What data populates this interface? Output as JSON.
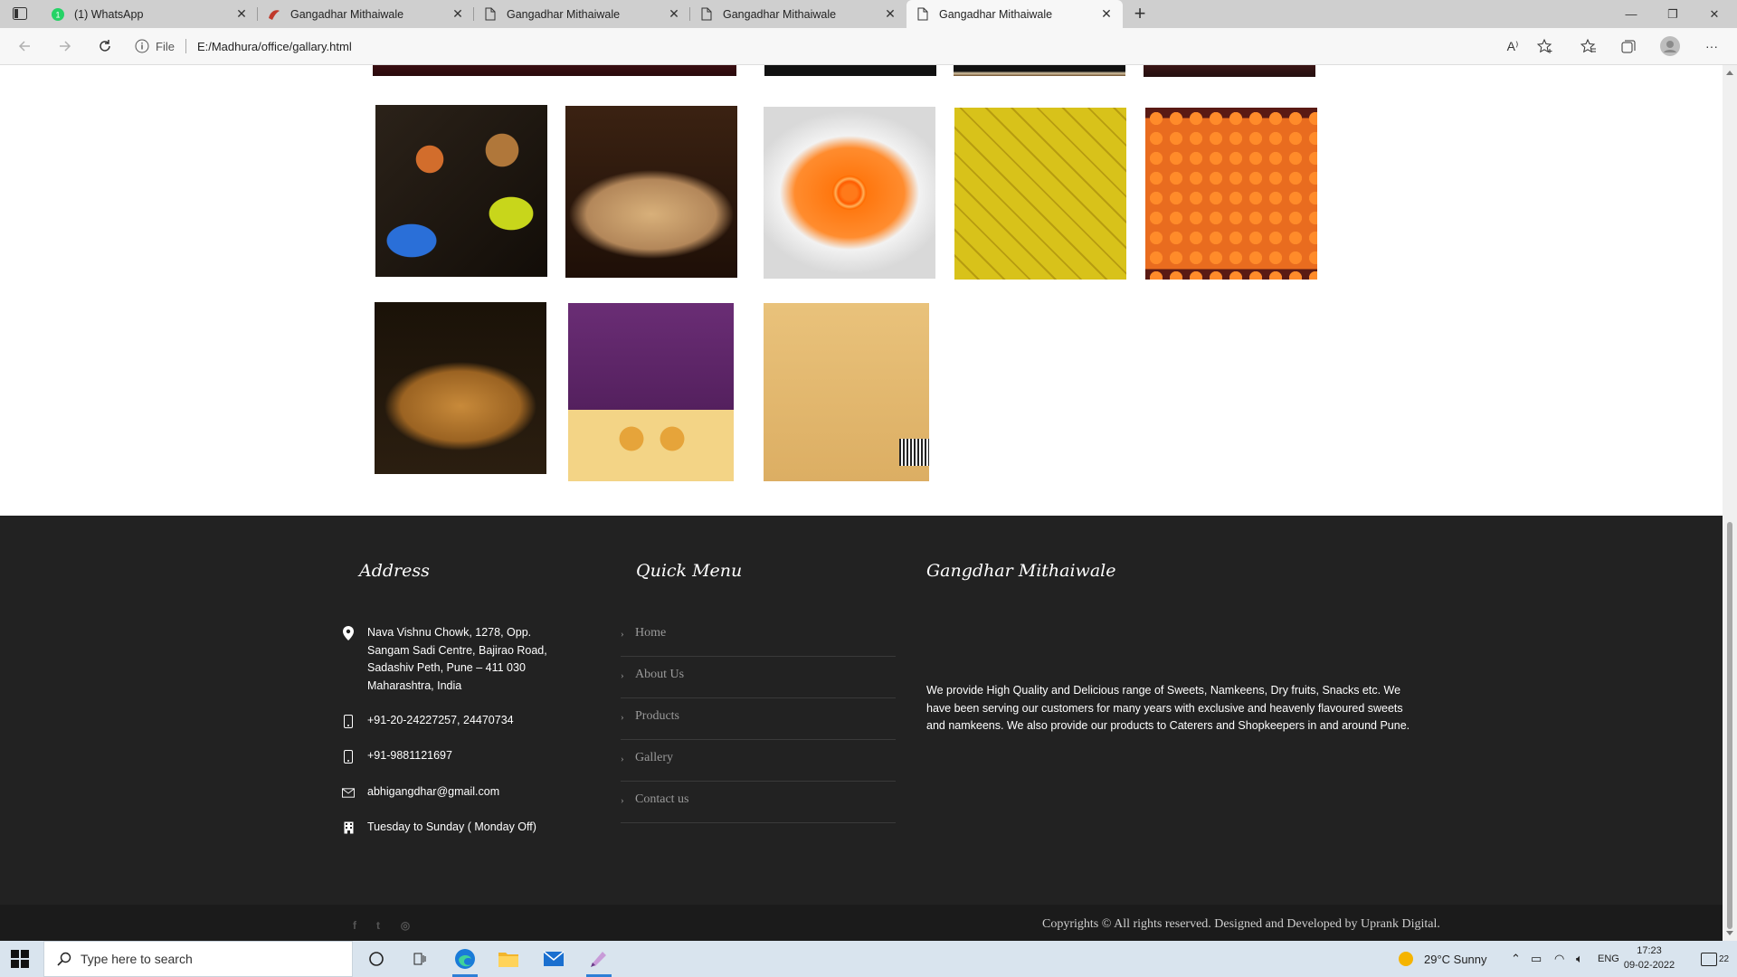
{
  "browser": {
    "tabs": [
      {
        "title": "(1) WhatsApp",
        "favicon": "whatsapp-icon",
        "active": false
      },
      {
        "title": "Gangadhar Mithaiwale",
        "favicon": "site-logo-icon",
        "active": false
      },
      {
        "title": "Gangadhar Mithaiwale",
        "favicon": "page-icon",
        "active": false
      },
      {
        "title": "Gangadhar Mithaiwale",
        "favicon": "page-icon",
        "active": false
      },
      {
        "title": "Gangadhar Mithaiwale",
        "favicon": "page-icon",
        "active": true
      }
    ],
    "address": {
      "scheme": "File",
      "url": "E:/Madhura/office/gallary.html"
    }
  },
  "gallery": {
    "images": [
      {
        "name": "spicy-snacks-bowls"
      },
      {
        "name": "sev-namkeen"
      },
      {
        "name": "jalebi"
      },
      {
        "name": "dhokla"
      },
      {
        "name": "boondi-laddu"
      },
      {
        "name": "chivda-mixture"
      },
      {
        "name": "besan-laddu-mix-box-front"
      },
      {
        "name": "besan-laddu-mix-box-back"
      }
    ]
  },
  "footer": {
    "address": {
      "title": "Address",
      "location": "Nava Vishnu Chowk, 1278, Opp. Sangam Sadi Centre, Bajirao Road, Sadashiv Peth, Pune – 411 030 Maharashtra, India",
      "phone1": "+91-20-24227257, 24470734",
      "phone2": "+91-9881121697",
      "email": "abhigangdhar@gmail.com",
      "hours": "Tuesday to Sunday ( Monday Off)"
    },
    "quick_menu": {
      "title": "Quick Menu",
      "items": [
        "Home",
        "About Us",
        "Products",
        "Gallery",
        "Contact us"
      ]
    },
    "about": {
      "title": "Gangdhar Mithaiwale",
      "text": "We provide High Quality and Delicious range of Sweets, Namkeens, Dry fruits, Snacks etc. We have been serving our customers for many years with exclusive and heavenly flavoured sweets and namkeens. We also provide our products to Caterers and Shopkeepers in and around Pune."
    },
    "social": {
      "facebook": "f",
      "twitter": "t",
      "instagram": "◎"
    },
    "copyright": "Copyrights © All rights reserved. Designed and Developed by Uprank Digital."
  },
  "taskbar": {
    "search_placeholder": "Type here to search",
    "weather": "29°C  Sunny",
    "language": "ENG",
    "time": "17:23",
    "date": "09-02-2022",
    "notifications": "22"
  },
  "colors": {
    "footer_bg": "#222222",
    "bottom_bar_bg": "#1b1b1b",
    "taskbar_bg": "#d9e4ee"
  }
}
